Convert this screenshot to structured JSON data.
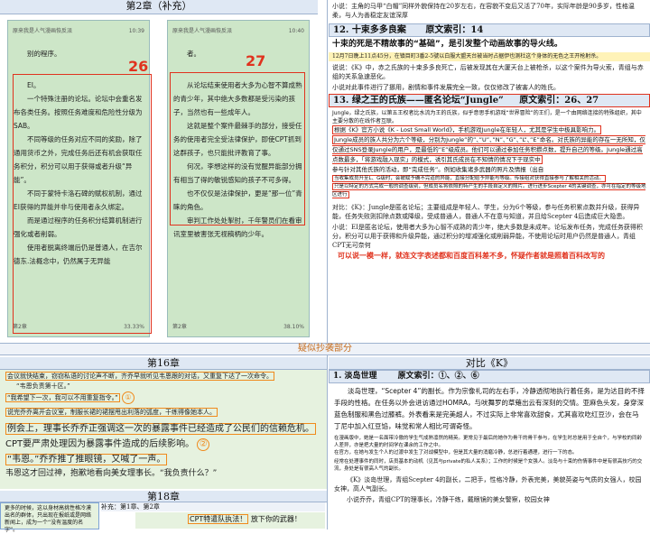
{
  "left_top": {
    "chapter": "第2章（补充）",
    "p1": {
      "status_title": "原来我是人气漫画恢反派",
      "time": "10:39",
      "number": "26",
      "paras": [
        "别的程序。",
        "EI。",
        "一个特殊注册的论坛。论坛中会重名发布各类任务。按照任务难度和危险性分级为SAB。",
        "不同等级的任务对应不同的奖励，除了通用货币之外，完成任务后还有机会获取任务积分，积分可以用于获得或者升级“异能”。",
        "不同于蒙特卡洛石碑的赋权机制，通过EI获得的异能并非与使用者永久绑定。",
        "而是通过程序的任务积分结算机制进行强化或者削弱。",
        "使用者脱离终端后仍是普通人，在吉尔德东.法概念中，仍然属于无异能"
      ],
      "footer_left": "第2章",
      "footer_right": "33.33%"
    },
    "p2": {
      "status_title": "原来我是人气漫画恢反派",
      "time": "10:40",
      "number": "27",
      "paras": [
        "者。",
        "从论坛结束使用者大多为心智不算成熟的青少年，其中绝大多数都是受污染的孩子，当然也有一些成年人。",
        "这就是整个案件最棘手的部分，接受任务的使用者完全受法律保护，即使CPT抓到这群孩子，也只能批评教育了事。",
        "何况，李想这样的没有觉醒异能部分拥有相当了得的敏锐感知的孩子不可多得。",
        "也不仅仅是法律保护，更是“那一位”青睐的角色。",
        "审判工作处处掣肘，千年警员们在看审讯室里被害张无视稿柄的少年。"
      ],
      "footer_left": "第2章",
      "footer_right": "38.10%"
    }
  },
  "left_mid": {
    "banner": "疑似抄袭部分",
    "chapter16": "第16章",
    "lines": [
      "会议就快结束，窃窃私语的讨论声不断，齐乔早就听见韦恩跟的对话，又重复下达了一次命令。",
      "“韦恩负责第十区。”",
      "“我希望下一次，我可以不用重复指令。”",
      "说完乔乔离开会议室，制服长裙的裙摆甩出利落的弧度，干练得像她本人。",
      "例会上，理事长乔乔正强调这一次的暴露事件已经造成了公民们的信赖危机。",
      "CPT要严肃处理因为暴露事件造成的后续影响。",
      "“韦恩。”乔乔推了推眼镜，又喊了一声。",
      "韦恩这才回过神，抱歉地看向美女理事长。“我负责什么？”"
    ],
    "circle1": "①",
    "circle2": "②"
  },
  "left_bot": {
    "chapter18": "第18章",
    "lines": [
      "更多的时候，这以身材高挑性格冷漠出名的群体，只出现在报纸或是网络新闻上，成为一个“没有温度的名字”。"
    ],
    "sub": "补充：第1章、第2章",
    "cpt_label": "CPT特遣队执法！",
    "cpt_tail": "放下你的武器！"
  },
  "right_top": {
    "lines": [
      "小说：主角的马甲“白帽”同样外貌保持在20岁左右，在容貌不变后又活了70年，实际年龄是90多岁，性格温柔，与人为善稳定友谊深厚"
    ],
    "sec12_title": "12. 十束多多良案",
    "sec12_idx": "原文索引：14",
    "sec12_big": "十束的死是不精故事的“基础”，是引发整个动画故事的导火线。",
    "sec12_note": "12月7日晚上11点45分，在镇目町3番2-5號以白服大盟天台被当时占据伊也测杜这个身体的无色之王开枪射杀。",
    "sec12_l1": "说说：《K》中，赤之氏族的十束多多良死亡，后被发现其在大厦天台上被枪杀，以这个案件为导火索，青组与赤组的关系急速恶化。",
    "sec12_l2": "小说对此事件进行了挪用，剧情和事件发展完全一致，仅仅修改了被害人的姓氏。",
    "sec13_title": "13. 绿之王的氏族——匿名论坛“Jungle”",
    "sec13_idx": "原文索引：26、27",
    "sec13_lines": [
      "Jungle，绿之氏族，以第五王权者比水流为王的氏族，似乎意思手机游戏“世界冒险”的王们，是一个由网络连接的特殊组织，其中主要分散的在线作者互联。",
      "根据《K》官方小说《K - Lost Small World》，手机游戏Jungle在年轻人，尤其是学生中极具影响力。",
      "Jungle成员的族人共分为六个等级，分别为Jungle”的”、”U”、”N”、”G”、”L”、”E”命名。对氏族的异能的存在一无所知，仅仅通过SNS登录Jungle的用户，是最低的”E”级成员。他们可以通过参加任务积攒点数，提升自己的等级。Jungle通过高点数最多，「将游戏融入现实」的模式，诱引其氏成员在不知情的情况下于现实中",
      "参与针对其他氏族的活动，即“完成任务”。例如收集诸多武器的照片及情报（出自",
      "当收集成员升至L、G级时，会被赋予确不完道的异能，直接分配给予异能与等级。传接组对获得直接参与了解相关的活动。",
      "只是以特定的方式完成一般的调查级别，但成员名将依照的特产生的手段自定义的照片。进行进步Scepter 4的关键调查，亦可在指定的等级地区进行"
    ],
    "cmp_lines": [
      "对比：《K》：Jungle是匿名论坛；主要组成是年轻人、学生，分为6个等级，参与任务积累点数并升级，获得异能，任务失败则扣除点数或降级，受成普通人，普通人不在意与知道，并且给Scepter 4后造成巨大隐患。",
      "小说：EI是匿名论坛，使用者大多为心智不成熟的青少年，绝大多数是未成年。论坛发布任务，完成任务获得积分，积分可以用于获得和升级异能，通过积分的增减强化或削弱异能，不使用论坛时用户仍然是普通人，青组CPT无可奈何"
    ],
    "red_note": "可以说一模一样，就连文字表述都和百度百科差不多，怀疑作者就是照着百科改写的"
  },
  "right_bot": {
    "compare": "对比《K》",
    "sec1_title": "1. 淡岛世理",
    "sec1_idx": "原文索引：①、②、⑥",
    "sec1_lines": [
      "淡岛世理，“Scepter 4”的副长。作为宗像礼司的左右手，冷静透彻地执行着任务，是为达目的不择手段的性格。在任务以外会进访通过HOMRA，与吠舞罗的草薙出云有深刻的交情。亚麻色头发，身穿深蓝色制服和黑色过膝裤。外表看来是完美超人，不过实际上非常喜欢甜食，尤其喜欢吃红豆沙，会在马丁尼中加入红豆馅，味觉和常人相比可谓奇怪。"
    ],
    "sec1_small": [
      "在漫画版中，她是一名面带冷傲的学生气成熟凛然的精英。更常见于最后的她作为骨干的骨干参与，在学生时总是用于全自个，与学校的同龄人差异，亦是把大量的时间学在课余的工作之中。",
      "在官方，在她与发生个人的过渡中发生了对战模型中，但是其大量的消磨冷静，总进行着通理，进行一下的态。"
    ],
    "sec1_small2": [
      "经常在处理事件的同时，店员基本的动机（见其与private的私人关系）；工作的时候是个女强人。淡岛与十束的伤情事件中是有很高技巧的交流，身处是有很高人气的副长。"
    ],
    "sec1_cmp1": "《K》淡岛世理，青组Scepter 4的副长，二把手，性格冷静，外表完美，美貌英姿与气质的女强人，校园女神，高人气副长。",
    "sec1_cmp2": "小说乔乔，青组CPT的理事长，冷静干练，戴眼镜的美女警察，校园女神"
  },
  "colors": {
    "red": "#e0321e",
    "orange": "#f08a1c",
    "blue": "#1d4fa8",
    "phone_bg": "#cde6c8"
  }
}
